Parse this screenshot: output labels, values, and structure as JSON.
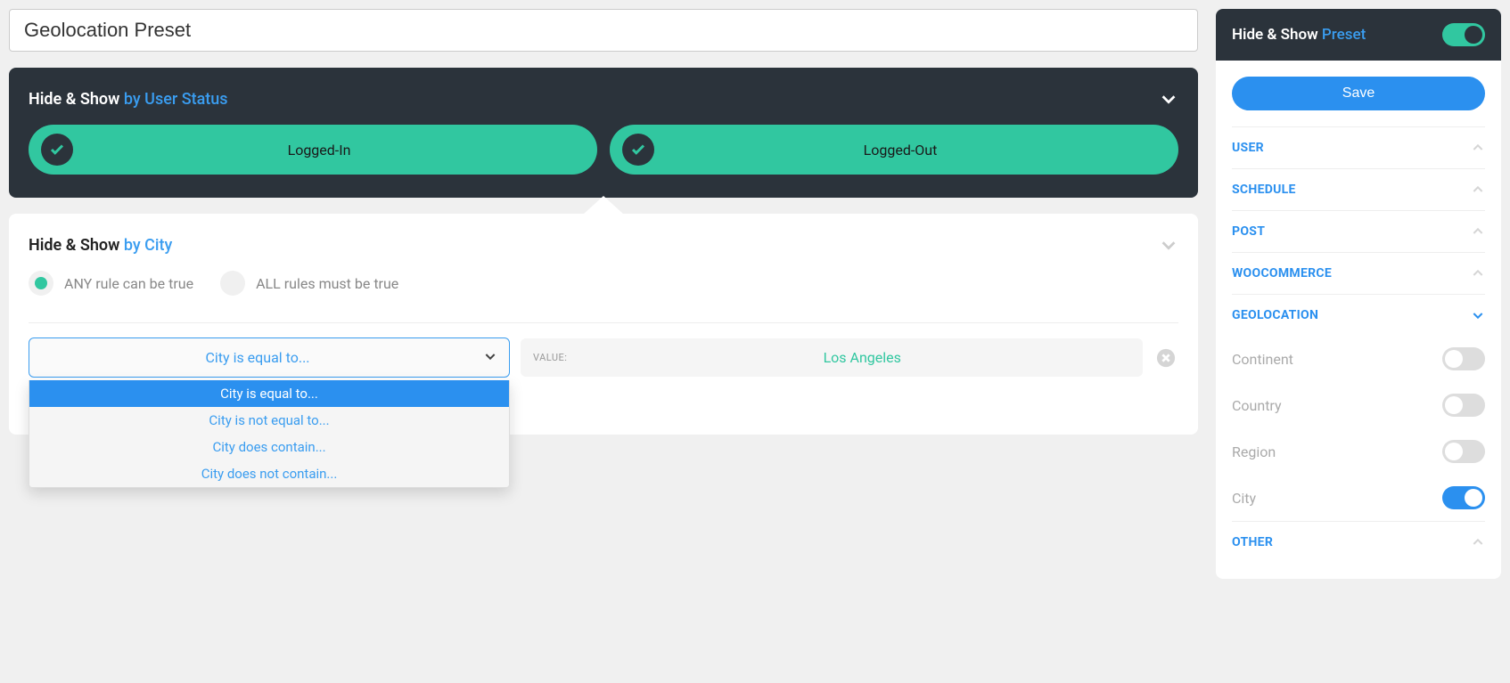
{
  "title_value": "Geolocation Preset",
  "user_status_panel": {
    "title_prefix": "Hide & Show ",
    "title_sub": "by User Status",
    "pill_logged_in": "Logged-In",
    "pill_logged_out": "Logged-Out"
  },
  "city_panel": {
    "title_prefix": "Hide & Show ",
    "title_sub": "by City",
    "radio_any": "ANY rule can be true",
    "radio_all": "ALL rules must be true",
    "select_display": "City is equal to...",
    "options": {
      "o0": "City is equal to...",
      "o1": "City is not equal to...",
      "o2": "City does contain...",
      "o3": "City does not contain..."
    },
    "value_label": "VALUE:",
    "value_text": "Los Angeles"
  },
  "sidebar": {
    "title_prefix": "Hide & Show ",
    "title_sub": "Preset",
    "save_label": "Save",
    "sections": {
      "user": "USER",
      "schedule": "SCHEDULE",
      "post": "POST",
      "woocommerce": "WOOCOMMERCE",
      "geolocation": "GEOLOCATION",
      "other": "OTHER"
    },
    "geo_items": {
      "continent": "Continent",
      "country": "Country",
      "region": "Region",
      "city": "City"
    }
  }
}
